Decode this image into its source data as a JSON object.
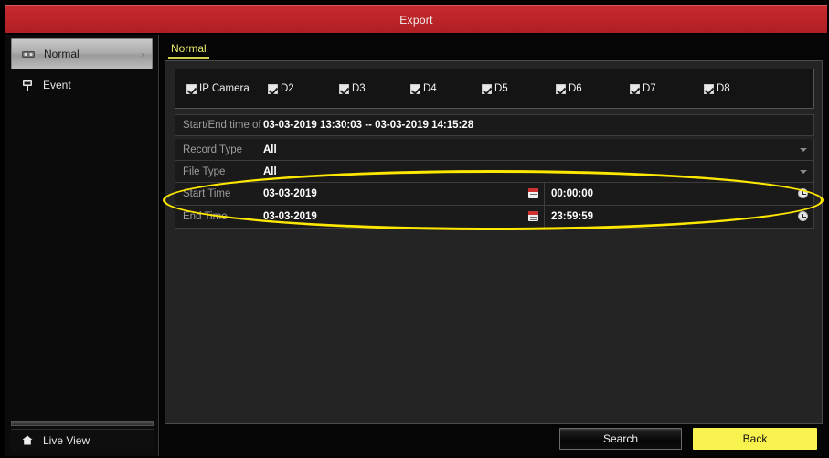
{
  "window": {
    "title": "Export"
  },
  "sidebar": {
    "items": [
      {
        "label": "Normal",
        "icon": "tape-icon",
        "selected": true,
        "chevron": "›"
      },
      {
        "label": "Event",
        "icon": "alarm-icon",
        "selected": false
      }
    ],
    "live_view": {
      "label": "Live View",
      "icon": "home-icon"
    }
  },
  "tabs": [
    {
      "label": "Normal",
      "active": true
    }
  ],
  "cameras": [
    {
      "label": "IP Camera",
      "checked": true
    },
    {
      "label": "D2",
      "checked": true
    },
    {
      "label": "D3",
      "checked": true
    },
    {
      "label": "D4",
      "checked": true
    },
    {
      "label": "D5",
      "checked": true
    },
    {
      "label": "D6",
      "checked": true
    },
    {
      "label": "D7",
      "checked": true
    },
    {
      "label": "D8",
      "checked": true
    }
  ],
  "fields": {
    "record_range": {
      "label": "Start/End time of rec",
      "value": "03-03-2019 13:30:03 -- 03-03-2019 14:15:28"
    },
    "record_type": {
      "label": "Record Type",
      "value": "All",
      "options": [
        "All"
      ]
    },
    "file_type": {
      "label": "File Type",
      "value": "All",
      "options": [
        "All"
      ]
    },
    "start_time": {
      "label": "Start Time",
      "date": "03-03-2019",
      "time": "00:00:00"
    },
    "end_time": {
      "label": "End Time",
      "date": "03-03-2019",
      "time": "23:59:59"
    }
  },
  "buttons": {
    "search": "Search",
    "back": "Back"
  },
  "colors": {
    "titlebar_red": "#bb2428",
    "accent_yellow": "#f7f24e",
    "annotation_yellow": "#ffe800",
    "tab_active": "#e9e86a"
  }
}
